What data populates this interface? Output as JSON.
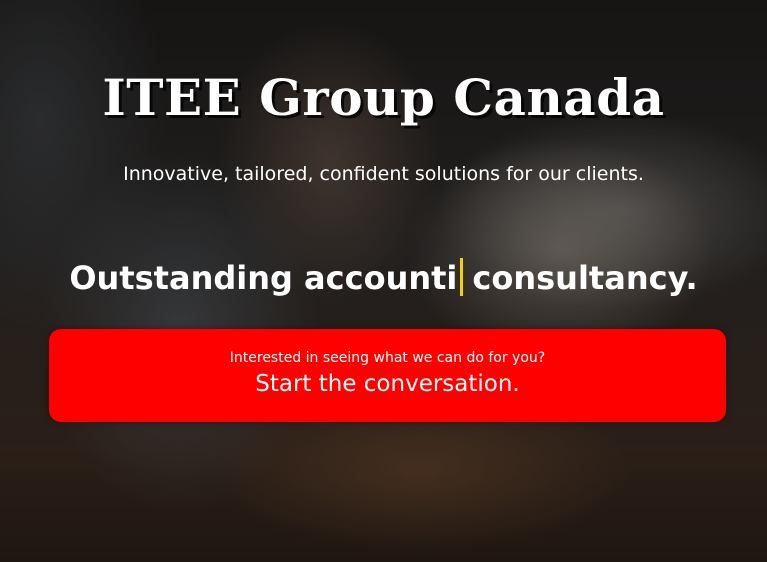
{
  "hero": {
    "title": "ITEE Group Canada",
    "tagline": "Innovative, tailored, confident solutions for our clients.",
    "typed_before_cursor": "Outstanding accounti",
    "typed_after_cursor": "consultancy.",
    "cursor_color": "#f2d200"
  },
  "cta": {
    "prompt": "Interested in seeing what we can do for you?",
    "label": "Start the conversation.",
    "color": "#ff0000"
  }
}
